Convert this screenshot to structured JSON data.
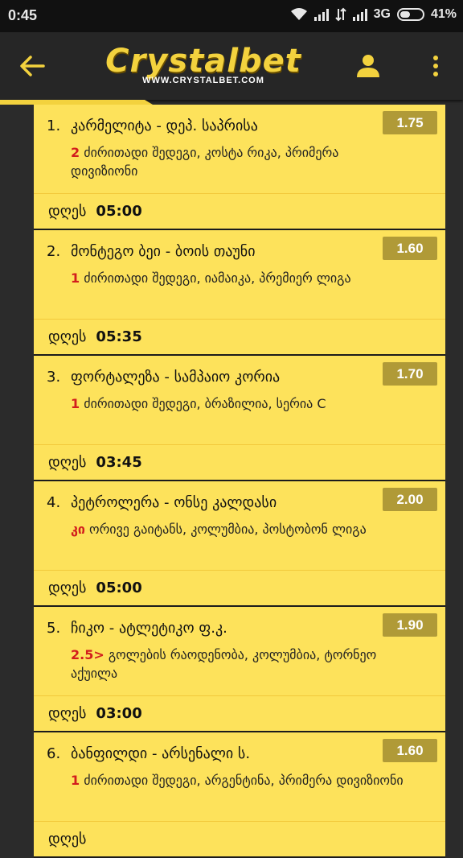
{
  "status_bar": {
    "time": "0:45",
    "network": "3G",
    "battery": "41%"
  },
  "app_bar": {
    "logo_brand": "Crystalbet",
    "logo_url": "WWW.CRYSTALBET.COM",
    "accent_color": "#f3d23e"
  },
  "bets": [
    {
      "number": "1.",
      "match": "კარმელიტა - დეპ. საპრისა",
      "odds": "1.75",
      "pick": "2",
      "market": " ძირითადი შედეგი, კოსტა რიკა, პრიმერა დივიზიონი",
      "day": "დღეს",
      "time": "05:00"
    },
    {
      "number": "2.",
      "match": "მონტეგო ბეი - ბოის თაუნი",
      "odds": "1.60",
      "pick": "1",
      "market": " ძირითადი შედეგი, იამაიკა, პრემიერ ლიგა",
      "day": "დღეს",
      "time": "05:35"
    },
    {
      "number": "3.",
      "match": "ფორტალეზა - სამპაიო კორია",
      "odds": "1.70",
      "pick": "1",
      "market": " ძირითადი შედეგი, ბრაზილია, სერია C",
      "day": "დღეს",
      "time": "03:45"
    },
    {
      "number": "4.",
      "match": "პეტროლერა - ონსე კალდასი",
      "odds": "2.00",
      "pick": "კი",
      "market": " ორივე გაიტანს, კოლუმბია, პოსტობონ ლიგა",
      "day": "დღეს",
      "time": "05:00"
    },
    {
      "number": "5.",
      "match": "ჩიკო - ატლეტიკო ფ.კ.",
      "odds": "1.90",
      "pick": "2.5>",
      "market": " გოლების რაოდენობა, კოლუმბია, ტორნეო აქუილა",
      "day": "დღეს",
      "time": "03:00"
    },
    {
      "number": "6.",
      "match": "ბანფილდი - არსენალი ს.",
      "odds": "1.60",
      "pick": "1",
      "market": " ძირითადი შედეგი, არგენტინა, პრიმერა დივიზიონი",
      "day": "დღეს",
      "time": ""
    }
  ]
}
